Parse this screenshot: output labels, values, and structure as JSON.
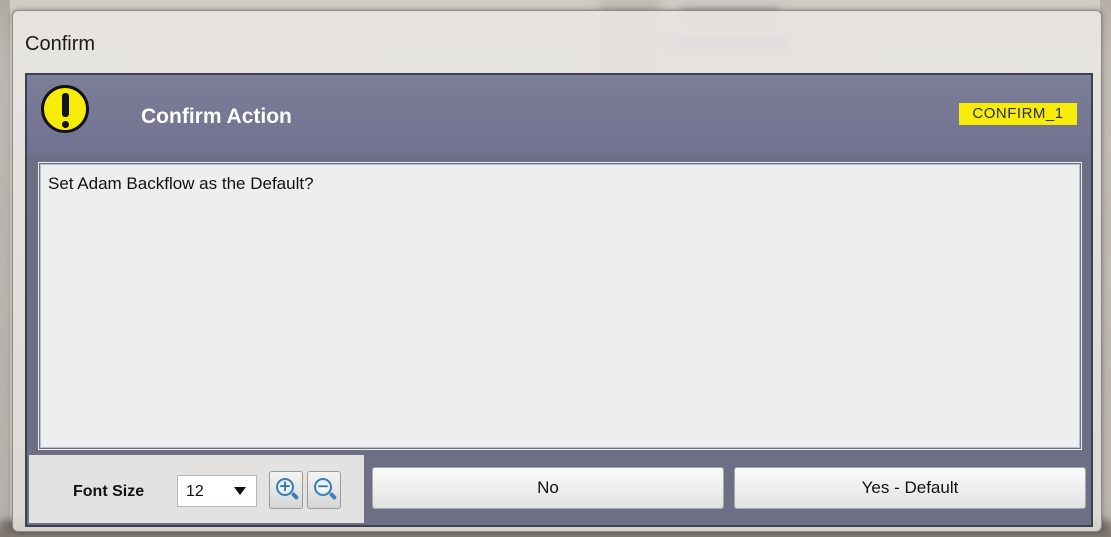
{
  "window": {
    "title": "Confirm"
  },
  "header": {
    "title": "Confirm Action",
    "code": "CONFIRM_1",
    "icon": "warning-icon",
    "accent_color": "#f6ec07",
    "bar_color": "#6f7190"
  },
  "message": {
    "text": "Set Adam Backflow as the Default?"
  },
  "footer": {
    "font_size_label": "Font Size",
    "font_size_value": "12",
    "zoom_in_icon": "zoom-in-icon",
    "zoom_out_icon": "zoom-out-icon"
  },
  "buttons": {
    "no_label": "No",
    "yes_label": "Yes - Default"
  }
}
